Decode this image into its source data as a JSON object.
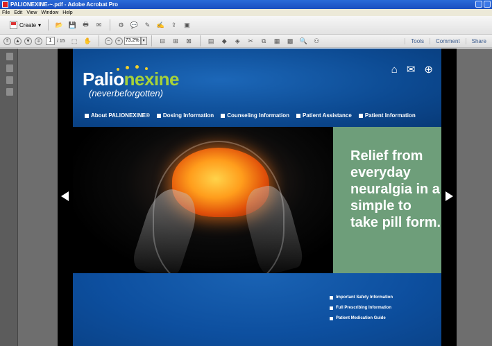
{
  "window": {
    "title": "PALIONEXINE-~.pdf - Adobe Acrobat Pro"
  },
  "menu": [
    "File",
    "Edit",
    "View",
    "Window",
    "Help"
  ],
  "toolbar": {
    "create_label": "Create"
  },
  "navigation": {
    "page_number": "1",
    "page_count": "/ 15",
    "zoom": "73.2%"
  },
  "panels": {
    "tools": "Tools",
    "comment": "Comment",
    "share": "Share"
  },
  "site": {
    "logo_part1": "Palio",
    "logo_part2": "nexine",
    "tagline": "(neverbeforgotten)",
    "header_icons": [
      "home-icon",
      "mail-icon",
      "globe-icon"
    ],
    "nav": [
      "About PALIONEXINE®",
      "Dosing Information",
      "Counseling Information",
      "Patient Assistance",
      "Patient Information"
    ],
    "hero_text": "Relief from everyday neuralgia in a simple to take pill form.",
    "links": [
      "Important Safety Information",
      "Full Prescribing Information",
      "Patient Medication Guide"
    ]
  },
  "colors": {
    "header_blue": "#0c4a92",
    "logo_green": "#a6d23a",
    "dot_yellow": "#f1d12c",
    "hero_green": "#6e9e7a"
  }
}
